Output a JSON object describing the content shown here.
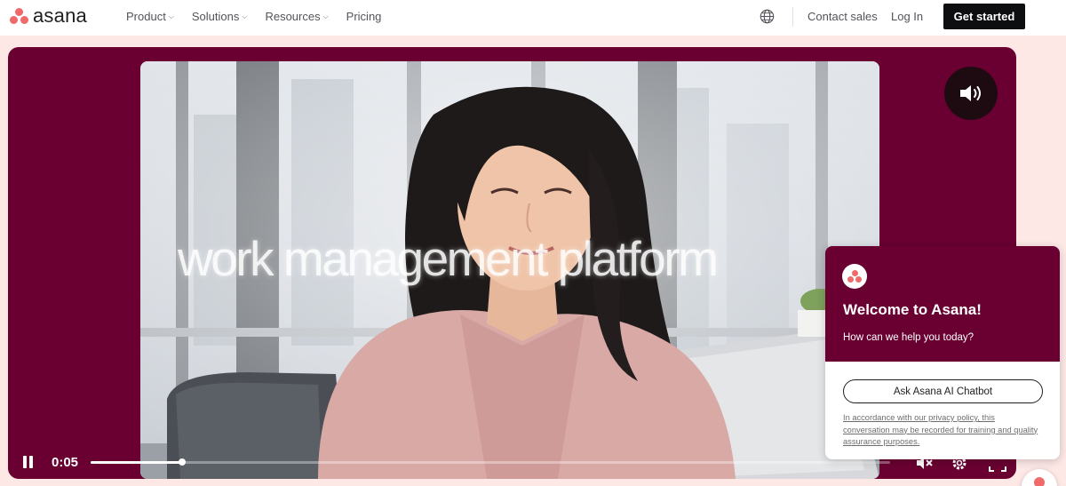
{
  "brand": {
    "name": "asana",
    "accent": "#f06a6a",
    "hero_bg": "#690031"
  },
  "nav": {
    "items": [
      {
        "label": "Product",
        "has_dropdown": true
      },
      {
        "label": "Solutions",
        "has_dropdown": true
      },
      {
        "label": "Resources",
        "has_dropdown": true
      },
      {
        "label": "Pricing",
        "has_dropdown": false
      }
    ],
    "globe_icon": "globe-icon",
    "contact_sales": "Contact sales",
    "login": "Log In",
    "cta": "Get started"
  },
  "video": {
    "overlay_text": "work management platform",
    "time": "0:05",
    "progress": 0.114,
    "state": "playing",
    "icons": [
      "pause-icon",
      "sound-on-icon",
      "mute-icon",
      "settings-icon",
      "fullscreen-icon"
    ]
  },
  "chat": {
    "title": "Welcome to Asana!",
    "subtitle": "How can we help you today?",
    "button": "Ask Asana AI Chatbot",
    "policy": "In accordance with our privacy policy, this conversation may be recorded for training and quality assurance purposes."
  }
}
